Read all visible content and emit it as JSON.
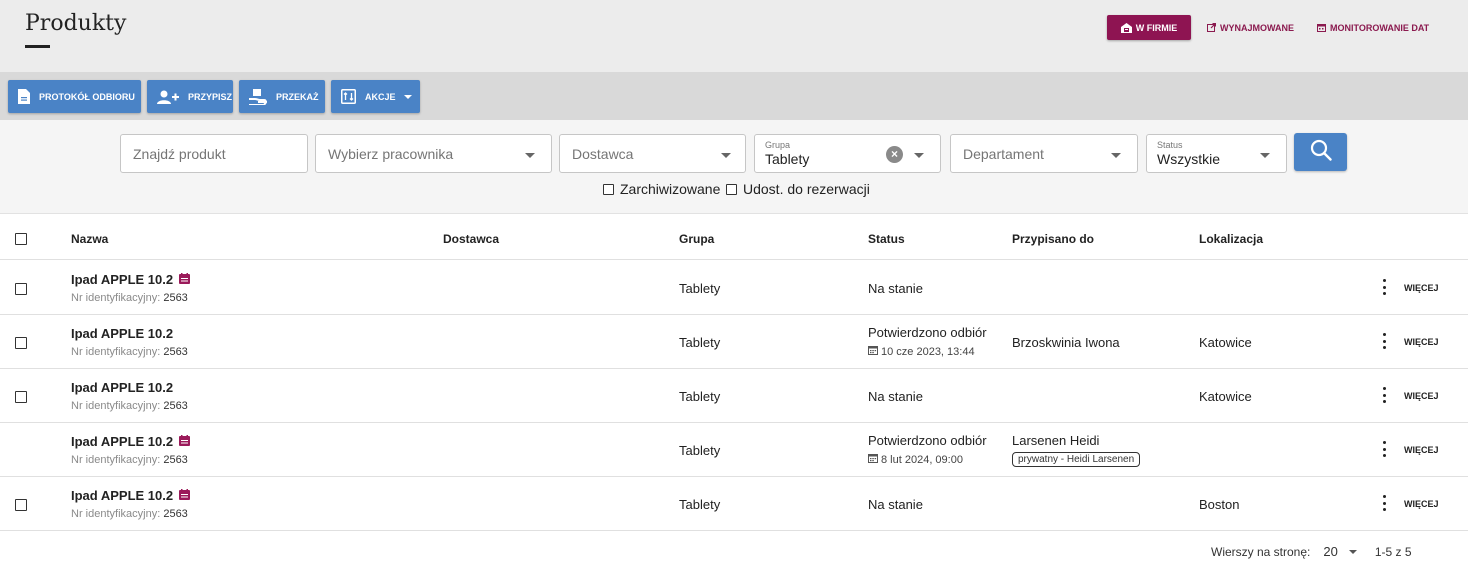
{
  "header": {
    "title": "Produkty",
    "views": [
      {
        "label": "W FIRMIE",
        "icon": "warehouse-icon",
        "active": true
      },
      {
        "label": "WYNAJMOWANE",
        "icon": "external-link-icon",
        "active": false
      },
      {
        "label": "MONITOROWANIE DAT",
        "icon": "calendar-icon",
        "active": false
      }
    ]
  },
  "toolbar": {
    "buttons": [
      {
        "label": "PROTOKÓŁ ODBIORU",
        "icon": "document-icon"
      },
      {
        "label": "PRZYPISZ",
        "icon": "add-user-icon"
      },
      {
        "label": "PRZEKAŻ",
        "icon": "hand-over-icon"
      },
      {
        "label": "AKCJE",
        "icon": "actions-icon"
      }
    ]
  },
  "filters": {
    "search_placeholder": "Znajdź produkt",
    "employee_placeholder": "Wybierz pracownika",
    "supplier_placeholder": "Dostawca",
    "group_label": "Grupa",
    "group_value": "Tablety",
    "department_placeholder": "Departament",
    "status_label": "Status",
    "status_value": "Wszystkie",
    "archived_label": "Zarchiwizowane",
    "reservation_label": "Udost. do rezerwacji"
  },
  "table": {
    "columns": {
      "name": "Nazwa",
      "supplier": "Dostawca",
      "group": "Grupa",
      "status": "Status",
      "assigned": "Przypisano do",
      "location": "Lokalizacja"
    },
    "id_label": "Nr identyfikacyjny:",
    "more_label": "WIĘCEJ",
    "rows": [
      {
        "name": "Ipad APPLE 10.2",
        "id": "2563",
        "calendar": true,
        "group": "Tablety",
        "status": "Na stanie",
        "date": "",
        "assigned": "",
        "tag": "",
        "location": "",
        "checkbox": true
      },
      {
        "name": "Ipad APPLE 10.2",
        "id": "2563",
        "calendar": false,
        "group": "Tablety",
        "status": "Potwierdzono odbiór",
        "date": "10 cze 2023, 13:44",
        "assigned": "Brzoskwinia Iwona",
        "tag": "",
        "location": "Katowice",
        "checkbox": true
      },
      {
        "name": "Ipad APPLE 10.2",
        "id": "2563",
        "calendar": false,
        "group": "Tablety",
        "status": "Na stanie",
        "date": "",
        "assigned": "",
        "tag": "",
        "location": "Katowice",
        "checkbox": true
      },
      {
        "name": "Ipad APPLE 10.2",
        "id": "2563",
        "calendar": true,
        "group": "Tablety",
        "status": "Potwierdzono odbiór",
        "date": "8 lut 2024, 09:00",
        "assigned": "Larsenen Heidi",
        "tag": "prywatny - Heidi Larsenen",
        "location": "",
        "checkbox": false
      },
      {
        "name": "Ipad APPLE 10.2",
        "id": "2563",
        "calendar": true,
        "group": "Tablety",
        "status": "Na stanie",
        "date": "",
        "assigned": "",
        "tag": "",
        "location": "Boston",
        "checkbox": true
      }
    ]
  },
  "pagination": {
    "rows_per_page_label": "Wierszy na stronę:",
    "rows_per_page": "20",
    "range": "1-5 z 5"
  },
  "colors": {
    "brand": "#8e1452",
    "primary_button": "#4a83c6",
    "calendar_marker": "#9b1a5a"
  }
}
